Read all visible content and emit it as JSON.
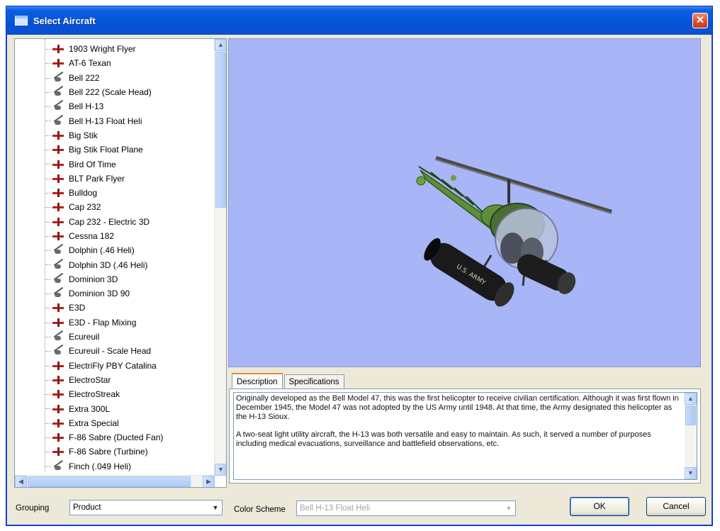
{
  "window": {
    "title": "Select Aircraft",
    "close_glyph": "✕"
  },
  "aircraft_list": {
    "items": [
      {
        "label": "1903 Wright Flyer",
        "icon": "airplane-icon"
      },
      {
        "label": "AT-6 Texan",
        "icon": "airplane-icon"
      },
      {
        "label": "Bell 222",
        "icon": "helicopter-icon"
      },
      {
        "label": "Bell 222 (Scale Head)",
        "icon": "helicopter-icon"
      },
      {
        "label": "Bell H-13",
        "icon": "helicopter-icon"
      },
      {
        "label": "Bell H-13 Float Heli",
        "icon": "helicopter-icon"
      },
      {
        "label": "Big Stik",
        "icon": "airplane-icon"
      },
      {
        "label": "Big Stik Float Plane",
        "icon": "airplane-icon"
      },
      {
        "label": "Bird Of Time",
        "icon": "airplane-icon"
      },
      {
        "label": "BLT Park Flyer",
        "icon": "airplane-icon"
      },
      {
        "label": "Bulldog",
        "icon": "airplane-icon"
      },
      {
        "label": "Cap 232",
        "icon": "airplane-icon"
      },
      {
        "label": "Cap 232 - Electric 3D",
        "icon": "airplane-icon"
      },
      {
        "label": "Cessna 182",
        "icon": "airplane-icon"
      },
      {
        "label": "Dolphin (.46 Heli)",
        "icon": "helicopter-icon"
      },
      {
        "label": "Dolphin 3D (.46 Heli)",
        "icon": "helicopter-icon"
      },
      {
        "label": "Dominion 3D",
        "icon": "helicopter-icon"
      },
      {
        "label": "Dominion 3D 90",
        "icon": "helicopter-icon"
      },
      {
        "label": "E3D",
        "icon": "airplane-icon"
      },
      {
        "label": "E3D - Flap Mixing",
        "icon": "airplane-icon"
      },
      {
        "label": "Ecureuil",
        "icon": "helicopter-icon"
      },
      {
        "label": "Ecureuil - Scale Head",
        "icon": "helicopter-icon"
      },
      {
        "label": "ElectriFly PBY Catalina",
        "icon": "airplane-icon"
      },
      {
        "label": "ElectroStar",
        "icon": "airplane-icon"
      },
      {
        "label": "ElectroStreak",
        "icon": "airplane-icon"
      },
      {
        "label": "Extra 300L",
        "icon": "airplane-icon"
      },
      {
        "label": "Extra Special",
        "icon": "airplane-icon"
      },
      {
        "label": "F-86 Sabre (Ducted Fan)",
        "icon": "airplane-icon"
      },
      {
        "label": "F-86 Sabre (Turbine)",
        "icon": "airplane-icon"
      },
      {
        "label": "Finch (.049 Heli)",
        "icon": "helicopter-icon"
      }
    ]
  },
  "tabs": {
    "description": "Description",
    "specifications": "Specifications"
  },
  "description": {
    "para1": "Originally developed as the Bell Model 47, this was the first helicopter to receive civilian certification. Although it was first flown in December 1945, the Model 47 was not adopted by the US Army until 1948. At that time, the Army designated this helicopter as the H-13 Sioux.",
    "para2": "A two-seat light utility aircraft, the H-13 was both versatile and easy to maintain. As such, it served a number of purposes including medical evacuations, surveillance and battlefield observations, etc."
  },
  "grouping": {
    "label": "Grouping",
    "value": "Product"
  },
  "color_scheme": {
    "label": "Color Scheme",
    "value": "Bell H-13 Float Heli"
  },
  "buttons": {
    "ok": "OK",
    "cancel": "Cancel"
  },
  "preview": {
    "float_marking": "U.S. ARMY"
  }
}
